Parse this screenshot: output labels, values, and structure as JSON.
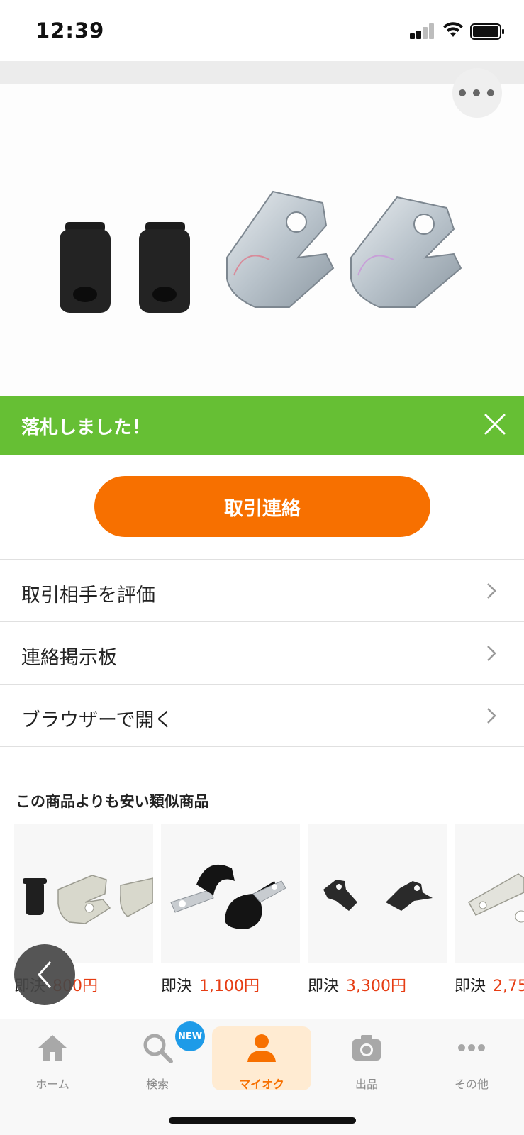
{
  "status_bar": {
    "time": "12:39"
  },
  "product": {
    "image_alt": "rubber grommets and metal clamps",
    "more_label": "•••"
  },
  "banner": {
    "text": "落札しました！",
    "color": "#66bf34"
  },
  "primary_action": {
    "label": "取引連絡",
    "color": "#f77000"
  },
  "menu": [
    {
      "label": "取引相手を評価"
    },
    {
      "label": "連絡掲示板"
    },
    {
      "label": "ブラウザーで開く"
    }
  ],
  "similar": {
    "title": "この商品よりも安い類似商品",
    "items": [
      {
        "price_label": "即決",
        "price": "800円"
      },
      {
        "price_label": "即決",
        "price": "1,100円"
      },
      {
        "price_label": "即決",
        "price": "3,300円"
      },
      {
        "price_label": "即決",
        "price": "2,75"
      }
    ]
  },
  "tabbar": {
    "items": [
      {
        "label": "ホーム",
        "icon": "home-icon"
      },
      {
        "label": "検索",
        "icon": "search-icon",
        "badge": "NEW"
      },
      {
        "label": "マイオク",
        "icon": "person-icon",
        "active": true
      },
      {
        "label": "出品",
        "icon": "camera-icon"
      },
      {
        "label": "その他",
        "icon": "more-icon"
      }
    ]
  },
  "colors": {
    "accent": "#f77000",
    "price": "#e63d14",
    "success": "#66bf34",
    "badge": "#1e9be8"
  }
}
